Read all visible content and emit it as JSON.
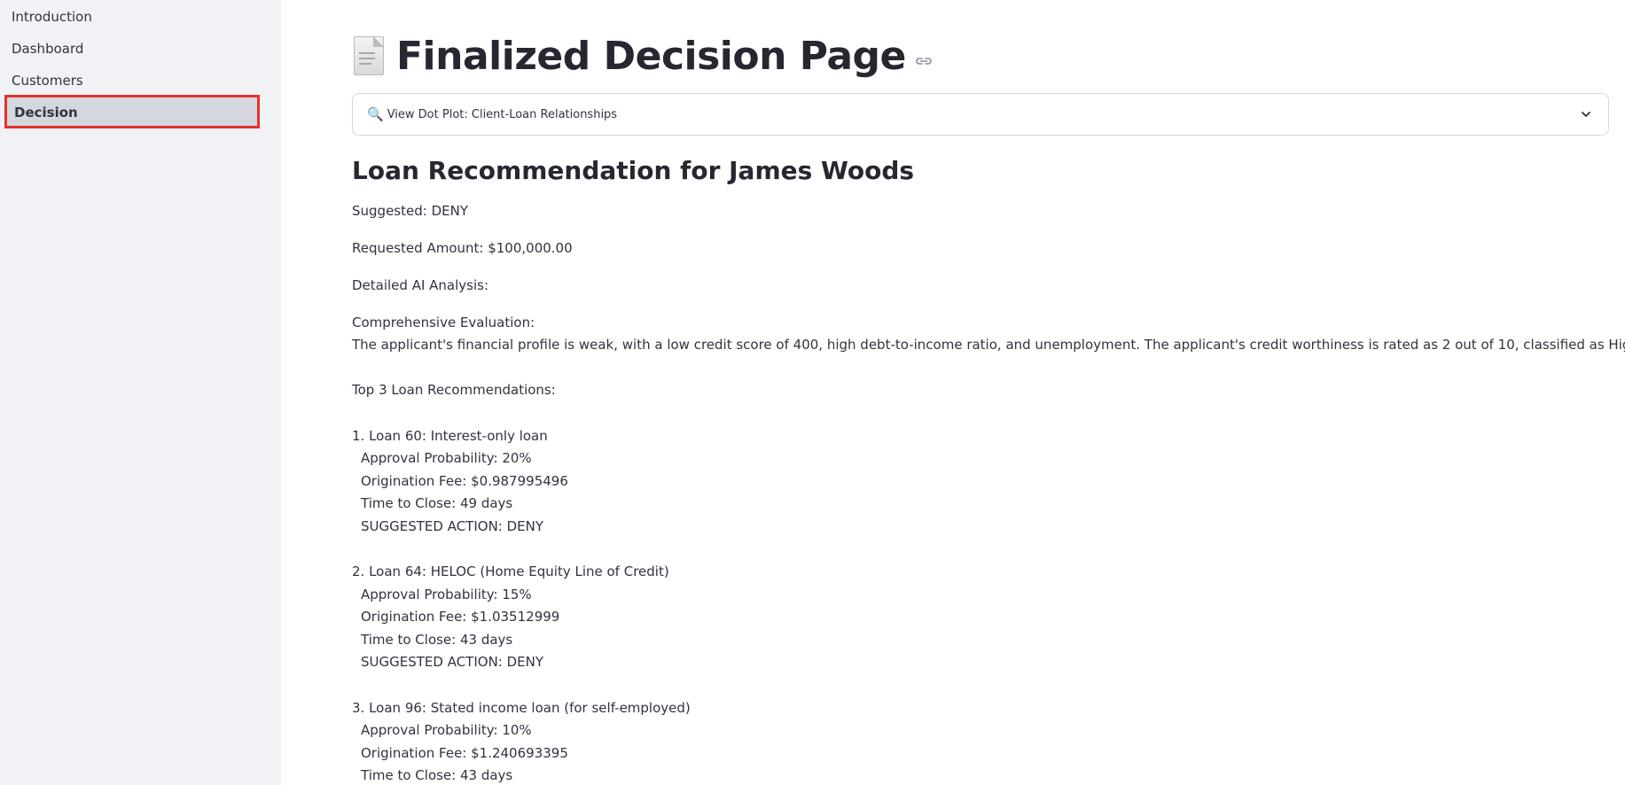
{
  "sidebar": {
    "items": [
      {
        "label": "Introduction"
      },
      {
        "label": "Dashboard"
      },
      {
        "label": "Customers"
      },
      {
        "label": "Decision"
      }
    ],
    "selected": "Decision"
  },
  "header": {
    "icon": "page-document-icon",
    "title": "Finalized Decision Page"
  },
  "expander": {
    "icon": "magnifier-icon",
    "label": "View Dot Plot: Client-Loan Relationships"
  },
  "recommendation": {
    "heading": "Loan Recommendation for James Woods",
    "suggested": "Suggested: DENY",
    "requested_amount": "Requested Amount: $100,000.00",
    "analysis_label": "Detailed AI Analysis:",
    "evaluation_label": "Comprehensive Evaluation:",
    "evaluation_text": "The applicant's financial profile is weak, with a low credit score of 400, high debt-to-income ratio, and unemployment. The applicant's credit worthiness is rated as 2 out of 10, classified as High Risk.",
    "top_label": "Top 3 Loan Recommendations:",
    "loans": [
      {
        "title": "1. Loan 60: Interest-only loan",
        "approval": "Approval Probability: 20%",
        "fee": "Origination Fee: $0.987995496",
        "time": "Time to Close: 49 days",
        "action": "SUGGESTED ACTION: DENY"
      },
      {
        "title": "2. Loan 64: HELOC (Home Equity Line of Credit)",
        "approval": "Approval Probability: 15%",
        "fee": "Origination Fee: $1.03512999",
        "time": "Time to Close: 43 days",
        "action": "SUGGESTED ACTION: DENY"
      },
      {
        "title": "3. Loan 96: Stated income loan (for self-employed)",
        "approval": "Approval Probability: 10%",
        "fee": "Origination Fee: $1.240693395",
        "time": "Time to Close: 43 days"
      }
    ]
  }
}
